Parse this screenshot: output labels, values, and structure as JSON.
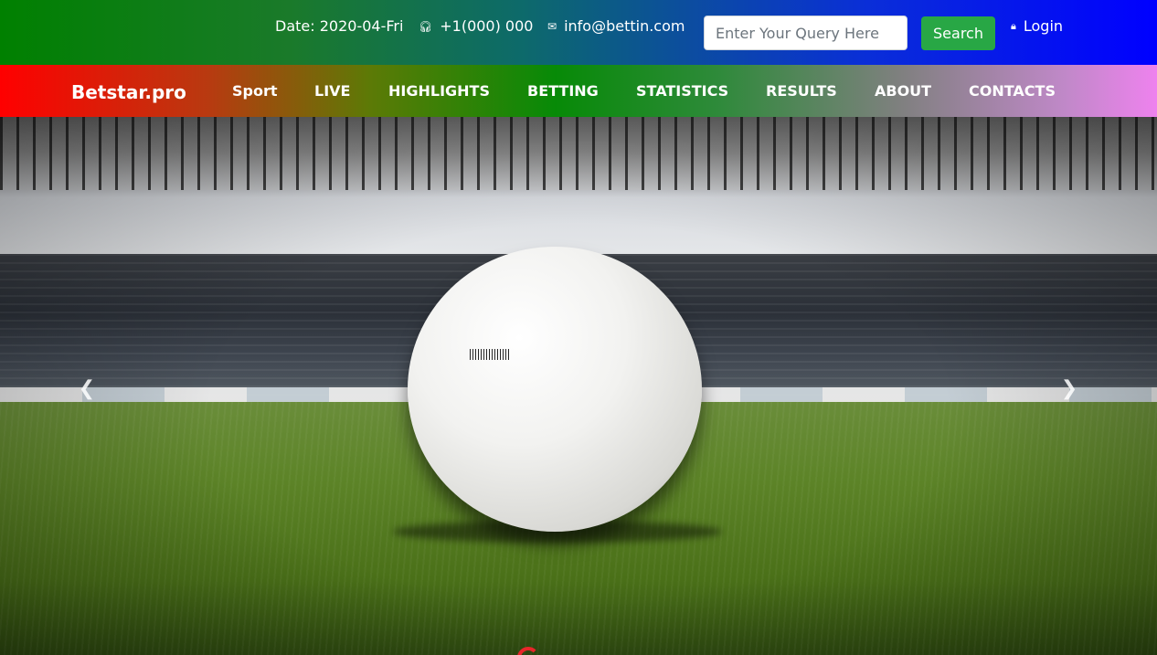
{
  "topbar": {
    "date": "Date: 2020-04-Fri",
    "phone": "+1(000) 000",
    "email": "info@bettin.com",
    "search_placeholder": "Enter Your Query Here",
    "search_label": "Search",
    "login_label": "Login",
    "icons": {
      "phone": "headphones-icon",
      "email": "envelope-icon",
      "login": "lock-icon"
    },
    "search_button_color": "#28a745"
  },
  "navbar": {
    "brand": "Betstar.pro",
    "items": [
      {
        "label": "Sport"
      },
      {
        "label": "LIVE"
      },
      {
        "label": "HIGHLIGHTS"
      },
      {
        "label": "BETTING"
      },
      {
        "label": "STATISTICS"
      },
      {
        "label": "RESULTS"
      },
      {
        "label": "ABOUT"
      },
      {
        "label": "CONTACTS"
      }
    ]
  },
  "hero": {
    "prev_icon": "chevron-left-icon",
    "next_icon": "chevron-right-icon",
    "prev_glyph": "❮",
    "next_glyph": "❯"
  }
}
